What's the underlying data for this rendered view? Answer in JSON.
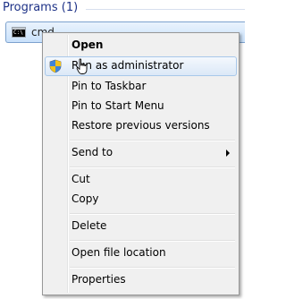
{
  "results": {
    "heading": "Programs (1)",
    "item": {
      "icon": "command-prompt-icon",
      "icon_glyph": "C:\\",
      "label": "cmd"
    }
  },
  "context_menu": {
    "items": [
      {
        "label": "Open",
        "bold": true
      },
      {
        "label": "Run as administrator",
        "icon": "uac-shield-icon",
        "highlighted": true
      },
      {
        "label": "Pin to Taskbar"
      },
      {
        "label": "Pin to Start Menu"
      },
      {
        "label": "Restore previous versions"
      },
      {
        "label": "Send to",
        "submenu": true
      },
      {
        "label": "Cut"
      },
      {
        "label": "Copy"
      },
      {
        "label": "Delete"
      },
      {
        "label": "Open file location"
      },
      {
        "label": "Properties"
      }
    ]
  },
  "colors": {
    "heading": "#1e3287",
    "selection_border": "#7da2ce",
    "menu_background": "#f0f0f0",
    "hover_border": "#a8c8ea"
  },
  "cursor": "hand-pointer-cursor-icon"
}
